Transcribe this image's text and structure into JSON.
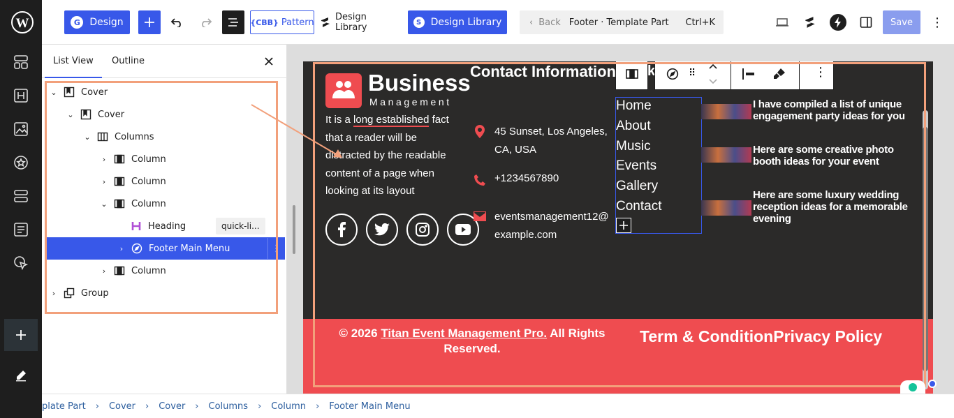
{
  "topbar": {
    "design_label": "Design",
    "cbb_badge": "{CBB}",
    "pattern_label": "Pattern",
    "design_library_label": "Design Library",
    "design_library_btn_label": "Design Library",
    "back_label": "Back",
    "doc_title": "Footer · Template Part",
    "shortcut": "Ctrl+K",
    "save_label": "Save"
  },
  "listview": {
    "tabs": [
      "List View",
      "Outline"
    ],
    "items": [
      {
        "label": "Cover"
      },
      {
        "label": "Cover"
      },
      {
        "label": "Columns"
      },
      {
        "label": "Column"
      },
      {
        "label": "Column"
      },
      {
        "label": "Column"
      },
      {
        "label": "Heading",
        "badge": "quick-li..."
      },
      {
        "label": "Footer Main Menu"
      },
      {
        "label": "Column"
      },
      {
        "label": "Group"
      }
    ]
  },
  "footer": {
    "brand_name": "Business",
    "brand_sub": "Management",
    "about_pre": "It is a ",
    "about_link": "long established",
    "about_post": " fact that a reader will be distracted by the readable content of a page when looking at its layout",
    "contact_heading": "Contact Information",
    "heading_fragment": "k",
    "address": "45 Sunset, Los Angeles, CA, USA",
    "phone": "+1234567890",
    "email_1": "eventsmanagement12@",
    "email_2": "example.com",
    "menu": [
      "Home",
      "About",
      "Music",
      "Events",
      "Gallery",
      "Contact"
    ],
    "posts": [
      "I have compiled a list of unique engagement party ideas for you",
      "Here are some creative photo booth ideas for your event",
      "Here are some luxury wedding reception ideas for a memorable evening"
    ],
    "copyright_pre": "© 2026 ",
    "copyright_link": "Titan Event Management Pro.",
    "copyright_post": " All Rights Reserved.",
    "terms": "Term & Condition",
    "privacy": "Privacy Policy"
  },
  "breadcrumb": [
    "plate Part",
    "Cover",
    "Cover",
    "Columns",
    "Column",
    "Footer Main Menu"
  ],
  "colors": {
    "accent": "#3858e9",
    "brand": "#ef4c50",
    "highlight": "#f2a07b",
    "footer_bg": "#2b2a29"
  }
}
